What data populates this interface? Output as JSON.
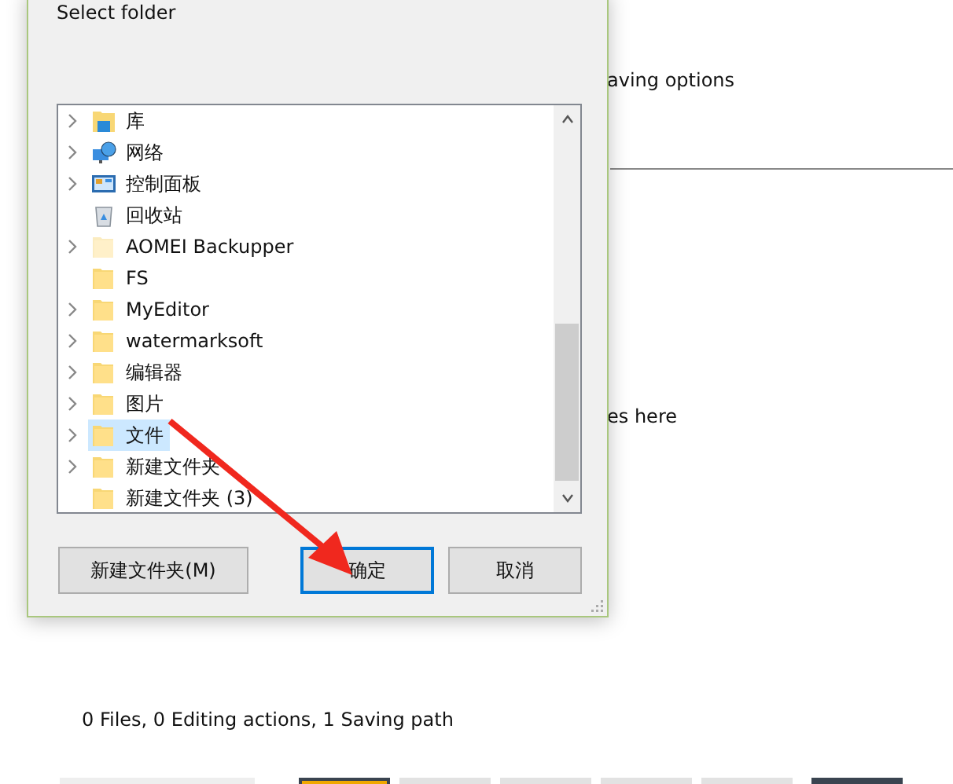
{
  "background": {
    "saving_options_text": "aving options",
    "drop_hint_text": "es here",
    "summary": "0 Files, 0 Editing actions, 1 Saving path",
    "bottom_buttons": [
      {
        "kind": "plain"
      },
      {
        "kind": "highlighted"
      },
      {
        "kind": "plain"
      },
      {
        "kind": "plain"
      },
      {
        "kind": "plain"
      },
      {
        "kind": "plain"
      },
      {
        "kind": "dark"
      }
    ]
  },
  "dialog": {
    "title": "Select folder",
    "tree": [
      {
        "label": "库",
        "kind": "library",
        "expandable": true,
        "hidden": false,
        "selected": false
      },
      {
        "label": "网络",
        "kind": "network",
        "expandable": true,
        "hidden": false,
        "selected": false
      },
      {
        "label": "控制面板",
        "kind": "control-panel",
        "expandable": true,
        "hidden": false,
        "selected": false
      },
      {
        "label": "回收站",
        "kind": "recycle-bin",
        "expandable": false,
        "hidden": false,
        "selected": false
      },
      {
        "label": "AOMEI Backupper",
        "kind": "folder",
        "expandable": true,
        "hidden": true,
        "selected": false
      },
      {
        "label": "FS",
        "kind": "folder",
        "expandable": false,
        "hidden": false,
        "selected": false
      },
      {
        "label": "MyEditor",
        "kind": "folder",
        "expandable": true,
        "hidden": false,
        "selected": false
      },
      {
        "label": "watermarksoft",
        "kind": "folder",
        "expandable": true,
        "hidden": false,
        "selected": false
      },
      {
        "label": "编辑器",
        "kind": "folder",
        "expandable": true,
        "hidden": false,
        "selected": false
      },
      {
        "label": "图片",
        "kind": "folder",
        "expandable": true,
        "hidden": false,
        "selected": false
      },
      {
        "label": "文件",
        "kind": "folder",
        "expandable": true,
        "hidden": false,
        "selected": true
      },
      {
        "label": "新建文件夹",
        "kind": "folder",
        "expandable": true,
        "hidden": false,
        "selected": false
      },
      {
        "label": "新建文件夹 (3)",
        "kind": "folder",
        "expandable": false,
        "hidden": false,
        "selected": false
      }
    ],
    "buttons": [
      {
        "label": "新建文件夹(M)",
        "focused": false
      },
      {
        "label": "确定",
        "focused": true
      },
      {
        "label": "取消",
        "focused": false
      }
    ]
  }
}
